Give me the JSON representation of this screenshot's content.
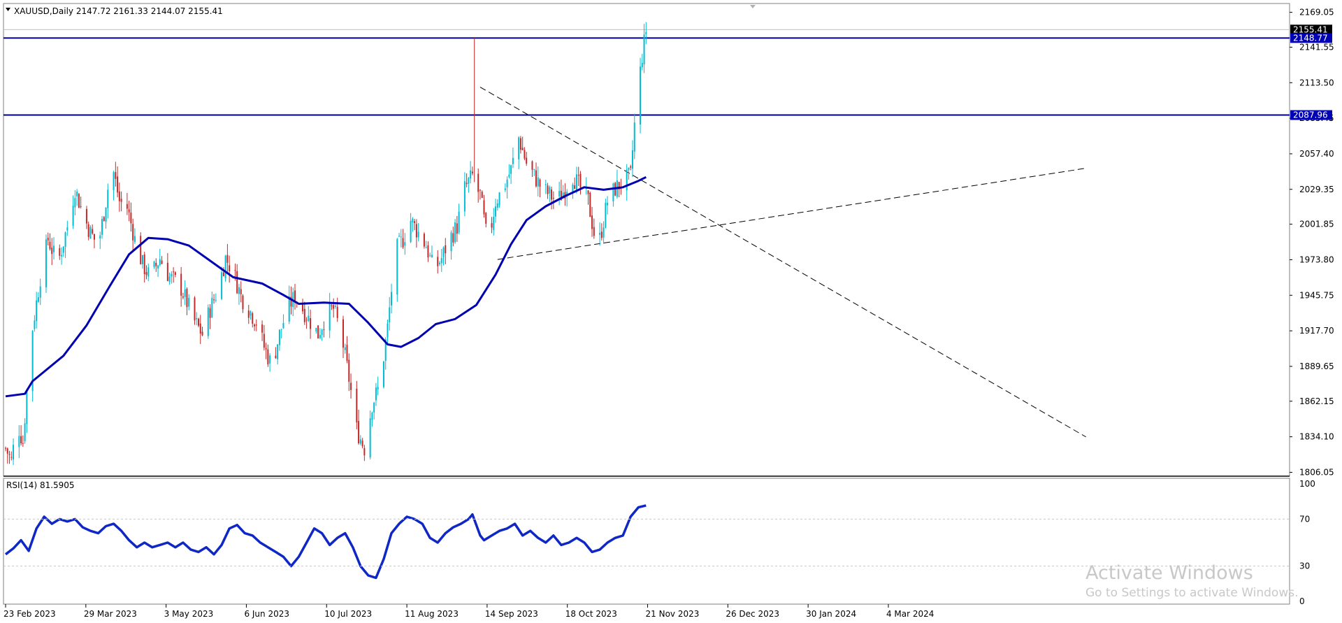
{
  "header": {
    "menu_icon": "triangle-down-icon",
    "symbol_line": "XAUUSD,Daily  2147.72 2161.33 2144.07 2155.41"
  },
  "rsi_header": "RSI(14) 81.5905",
  "watermark": {
    "title": "Activate Windows",
    "subtitle": "Go to Settings to activate Windows."
  },
  "colors": {
    "bull": "#00bcd4",
    "bear": "#c62828",
    "ma": "#0000b0",
    "hline": "#000080",
    "rsi": "#0f27c4",
    "trend": "#000000",
    "badge_dark": "#000000",
    "badge_blue": "#0000b4"
  },
  "chart_data": [
    {
      "type": "candlestick",
      "title": "XAUUSD,Daily",
      "ohlc_header": {
        "open": 2147.72,
        "high": 2161.33,
        "low": 2144.07,
        "close": 2155.41
      },
      "y_ticks": [
        2169.05,
        2141.55,
        2113.5,
        2085.45,
        2057.4,
        2029.35,
        2001.85,
        1973.8,
        1945.75,
        1917.7,
        1889.65,
        1862.15,
        1834.1,
        1806.05
      ],
      "ylim": [
        1803.0,
        2176.0
      ],
      "x_date_labels": [
        "23 Feb 2023",
        "29 Mar 2023",
        "3 May 2023",
        "6 Jun 2023",
        "10 Jul 2023",
        "11 Aug 2023",
        "14 Sep 2023",
        "18 Oct 2023",
        "21 Nov 2023",
        "26 Dec 2023",
        "30 Jan 2024",
        "4 Mar 2024"
      ],
      "price_badges": [
        {
          "value": 2155.41,
          "label": "2155.41",
          "style": "dark"
        },
        {
          "value": 2148.77,
          "label": "2148.77",
          "style": "blue"
        },
        {
          "value": 2087.96,
          "label": "2087.96",
          "style": "blue"
        }
      ],
      "horizontal_levels": [
        2148.77,
        2087.96
      ],
      "series_keypoints": [
        {
          "d": 0,
          "p": 1825
        },
        {
          "d": 3,
          "p": 1815
        },
        {
          "d": 6,
          "p": 1845
        },
        {
          "d": 9,
          "p": 1830
        },
        {
          "d": 11,
          "p": 1870
        },
        {
          "d": 14,
          "p": 1920
        },
        {
          "d": 18,
          "p": 1960
        },
        {
          "d": 22,
          "p": 1990
        },
        {
          "d": 27,
          "p": 1970
        },
        {
          "d": 32,
          "p": 2000
        },
        {
          "d": 36,
          "p": 2030
        },
        {
          "d": 40,
          "p": 2010
        },
        {
          "d": 44,
          "p": 1995
        },
        {
          "d": 48,
          "p": 1985
        },
        {
          "d": 52,
          "p": 2020
        },
        {
          "d": 55,
          "p": 2050
        },
        {
          "d": 59,
          "p": 2020
        },
        {
          "d": 63,
          "p": 2015
        },
        {
          "d": 67,
          "p": 1990
        },
        {
          "d": 71,
          "p": 1970
        },
        {
          "d": 75,
          "p": 1960
        },
        {
          "d": 80,
          "p": 1975
        },
        {
          "d": 85,
          "p": 1960
        },
        {
          "d": 90,
          "p": 1955
        },
        {
          "d": 94,
          "p": 1940
        },
        {
          "d": 98,
          "p": 1925
        },
        {
          "d": 102,
          "p": 1915
        },
        {
          "d": 106,
          "p": 1935
        },
        {
          "d": 110,
          "p": 1950
        },
        {
          "d": 114,
          "p": 1975
        },
        {
          "d": 118,
          "p": 1965
        },
        {
          "d": 122,
          "p": 1945
        },
        {
          "d": 126,
          "p": 1935
        },
        {
          "d": 130,
          "p": 1925
        },
        {
          "d": 134,
          "p": 1905
        },
        {
          "d": 138,
          "p": 1890
        },
        {
          "d": 142,
          "p": 1915
        },
        {
          "d": 146,
          "p": 1935
        },
        {
          "d": 150,
          "p": 1945
        },
        {
          "d": 154,
          "p": 1935
        },
        {
          "d": 158,
          "p": 1925
        },
        {
          "d": 162,
          "p": 1915
        },
        {
          "d": 166,
          "p": 1930
        },
        {
          "d": 170,
          "p": 1935
        },
        {
          "d": 174,
          "p": 1915
        },
        {
          "d": 178,
          "p": 1880
        },
        {
          "d": 182,
          "p": 1840
        },
        {
          "d": 186,
          "p": 1825
        },
        {
          "d": 190,
          "p": 1860
        },
        {
          "d": 194,
          "p": 1875
        },
        {
          "d": 198,
          "p": 1920
        },
        {
          "d": 202,
          "p": 1980
        },
        {
          "d": 206,
          "p": 1990
        },
        {
          "d": 210,
          "p": 2005
        },
        {
          "d": 214,
          "p": 1995
        },
        {
          "d": 218,
          "p": 1985
        },
        {
          "d": 222,
          "p": 1965
        },
        {
          "d": 226,
          "p": 1975
        },
        {
          "d": 230,
          "p": 1990
        },
        {
          "d": 234,
          "p": 2000
        },
        {
          "d": 238,
          "p": 2030
        },
        {
          "d": 242,
          "p": 2040
        },
        {
          "d": 244,
          "p": 2030
        },
        {
          "d": 246,
          "p": 2025
        },
        {
          "d": 250,
          "p": 1985
        },
        {
          "d": 254,
          "p": 2020
        },
        {
          "d": 258,
          "p": 2030
        },
        {
          "d": 262,
          "p": 2045
        },
        {
          "d": 266,
          "p": 2070
        },
        {
          "d": 270,
          "p": 2050
        },
        {
          "d": 274,
          "p": 2040
        },
        {
          "d": 278,
          "p": 2030
        },
        {
          "d": 282,
          "p": 2025
        },
        {
          "d": 286,
          "p": 2020
        },
        {
          "d": 290,
          "p": 2030
        },
        {
          "d": 294,
          "p": 2040
        },
        {
          "d": 298,
          "p": 2030
        },
        {
          "d": 302,
          "p": 2020
        },
        {
          "d": 305,
          "p": 1995
        },
        {
          "d": 308,
          "p": 1990
        },
        {
          "d": 312,
          "p": 2020
        },
        {
          "d": 316,
          "p": 2030
        },
        {
          "d": 320,
          "p": 2035
        },
        {
          "d": 324,
          "p": 2040
        },
        {
          "d": 326,
          "p": 2080
        },
        {
          "d": 328,
          "p": 2110
        },
        {
          "d": 330,
          "p": 2135
        },
        {
          "d": 332,
          "p": 2155
        }
      ],
      "moving_average": [
        {
          "d": 0,
          "p": 1866
        },
        {
          "d": 10,
          "p": 1868
        },
        {
          "d": 14,
          "p": 1878
        },
        {
          "d": 30,
          "p": 1898
        },
        {
          "d": 42,
          "p": 1922
        },
        {
          "d": 54,
          "p": 1953
        },
        {
          "d": 64,
          "p": 1978
        },
        {
          "d": 74,
          "p": 1991
        },
        {
          "d": 84,
          "p": 1990
        },
        {
          "d": 95,
          "p": 1985
        },
        {
          "d": 106,
          "p": 1973
        },
        {
          "d": 118,
          "p": 1960
        },
        {
          "d": 133,
          "p": 1955
        },
        {
          "d": 144,
          "p": 1946
        },
        {
          "d": 152,
          "p": 1939
        },
        {
          "d": 165,
          "p": 1940
        },
        {
          "d": 178,
          "p": 1939
        },
        {
          "d": 188,
          "p": 1924
        },
        {
          "d": 198,
          "p": 1907
        },
        {
          "d": 205,
          "p": 1905
        },
        {
          "d": 214,
          "p": 1912
        },
        {
          "d": 223,
          "p": 1923
        },
        {
          "d": 233,
          "p": 1927
        },
        {
          "d": 244,
          "p": 1938
        },
        {
          "d": 254,
          "p": 1962
        },
        {
          "d": 262,
          "p": 1986
        },
        {
          "d": 270,
          "p": 2005
        },
        {
          "d": 280,
          "p": 2016
        },
        {
          "d": 290,
          "p": 2024
        },
        {
          "d": 300,
          "p": 2031
        },
        {
          "d": 310,
          "p": 2029
        },
        {
          "d": 320,
          "p": 2031
        },
        {
          "d": 328,
          "p": 2036
        },
        {
          "d": 332,
          "p": 2039
        }
      ],
      "trendlines": [
        {
          "from": {
            "d": 246,
            "p": 2110
          },
          "to": {
            "d": 560,
            "p": 1834
          }
        },
        {
          "from": {
            "d": 255,
            "p": 1974
          },
          "to": {
            "d": 560,
            "p": 2046
          }
        }
      ]
    },
    {
      "type": "line",
      "title": "RSI(14) 81.5905",
      "last_value": 81.5905,
      "y_ticks": [
        100,
        70,
        30,
        0
      ],
      "levels": [
        70,
        30
      ],
      "ylim": [
        0,
        100
      ],
      "series": [
        {
          "d": 0,
          "v": 40
        },
        {
          "d": 4,
          "v": 45
        },
        {
          "d": 8,
          "v": 52
        },
        {
          "d": 12,
          "v": 43
        },
        {
          "d": 16,
          "v": 62
        },
        {
          "d": 20,
          "v": 72
        },
        {
          "d": 24,
          "v": 66
        },
        {
          "d": 28,
          "v": 70
        },
        {
          "d": 32,
          "v": 68
        },
        {
          "d": 36,
          "v": 70
        },
        {
          "d": 40,
          "v": 63
        },
        {
          "d": 44,
          "v": 60
        },
        {
          "d": 48,
          "v": 58
        },
        {
          "d": 52,
          "v": 64
        },
        {
          "d": 56,
          "v": 66
        },
        {
          "d": 60,
          "v": 60
        },
        {
          "d": 64,
          "v": 52
        },
        {
          "d": 68,
          "v": 46
        },
        {
          "d": 72,
          "v": 50
        },
        {
          "d": 76,
          "v": 46
        },
        {
          "d": 80,
          "v": 48
        },
        {
          "d": 84,
          "v": 50
        },
        {
          "d": 88,
          "v": 46
        },
        {
          "d": 92,
          "v": 50
        },
        {
          "d": 96,
          "v": 44
        },
        {
          "d": 100,
          "v": 42
        },
        {
          "d": 104,
          "v": 46
        },
        {
          "d": 108,
          "v": 40
        },
        {
          "d": 112,
          "v": 48
        },
        {
          "d": 116,
          "v": 62
        },
        {
          "d": 120,
          "v": 65
        },
        {
          "d": 124,
          "v": 58
        },
        {
          "d": 128,
          "v": 56
        },
        {
          "d": 132,
          "v": 50
        },
        {
          "d": 136,
          "v": 46
        },
        {
          "d": 140,
          "v": 42
        },
        {
          "d": 144,
          "v": 38
        },
        {
          "d": 148,
          "v": 30
        },
        {
          "d": 152,
          "v": 38
        },
        {
          "d": 156,
          "v": 50
        },
        {
          "d": 160,
          "v": 62
        },
        {
          "d": 164,
          "v": 58
        },
        {
          "d": 168,
          "v": 48
        },
        {
          "d": 172,
          "v": 54
        },
        {
          "d": 176,
          "v": 58
        },
        {
          "d": 180,
          "v": 46
        },
        {
          "d": 184,
          "v": 30
        },
        {
          "d": 188,
          "v": 22
        },
        {
          "d": 192,
          "v": 20
        },
        {
          "d": 196,
          "v": 36
        },
        {
          "d": 200,
          "v": 58
        },
        {
          "d": 204,
          "v": 66
        },
        {
          "d": 208,
          "v": 72
        },
        {
          "d": 212,
          "v": 70
        },
        {
          "d": 216,
          "v": 66
        },
        {
          "d": 220,
          "v": 54
        },
        {
          "d": 224,
          "v": 50
        },
        {
          "d": 228,
          "v": 58
        },
        {
          "d": 232,
          "v": 63
        },
        {
          "d": 236,
          "v": 66
        },
        {
          "d": 240,
          "v": 70
        },
        {
          "d": 242,
          "v": 74
        },
        {
          "d": 246,
          "v": 56
        },
        {
          "d": 248,
          "v": 52
        },
        {
          "d": 252,
          "v": 56
        },
        {
          "d": 256,
          "v": 60
        },
        {
          "d": 260,
          "v": 62
        },
        {
          "d": 264,
          "v": 66
        },
        {
          "d": 268,
          "v": 56
        },
        {
          "d": 272,
          "v": 60
        },
        {
          "d": 276,
          "v": 54
        },
        {
          "d": 280,
          "v": 50
        },
        {
          "d": 284,
          "v": 56
        },
        {
          "d": 288,
          "v": 48
        },
        {
          "d": 292,
          "v": 50
        },
        {
          "d": 296,
          "v": 54
        },
        {
          "d": 300,
          "v": 50
        },
        {
          "d": 304,
          "v": 42
        },
        {
          "d": 308,
          "v": 44
        },
        {
          "d": 312,
          "v": 50
        },
        {
          "d": 316,
          "v": 54
        },
        {
          "d": 320,
          "v": 56
        },
        {
          "d": 324,
          "v": 72
        },
        {
          "d": 328,
          "v": 80
        },
        {
          "d": 332,
          "v": 81.59
        }
      ]
    }
  ]
}
